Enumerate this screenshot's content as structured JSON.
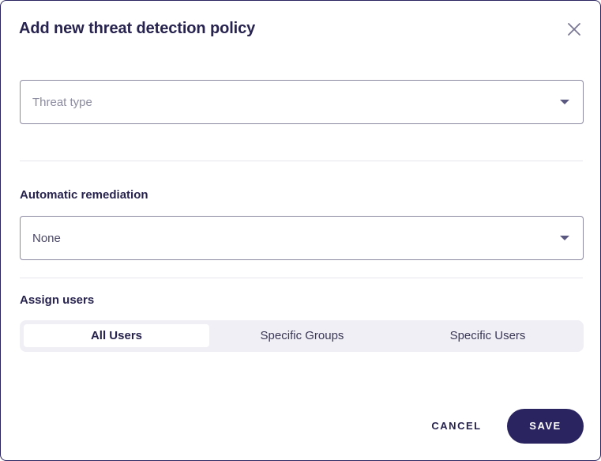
{
  "dialog": {
    "title": "Add new threat detection policy",
    "close_icon": "close-icon"
  },
  "threat_type": {
    "placeholder": "Threat type",
    "value": ""
  },
  "remediation": {
    "label": "Automatic remediation",
    "value": "None"
  },
  "assign_users": {
    "label": "Assign users",
    "options": [
      "All Users",
      "Specific Groups",
      "Specific Users"
    ],
    "selected": "All Users"
  },
  "actions": {
    "cancel_label": "CANCEL",
    "save_label": "SAVE"
  },
  "colors": {
    "primary": "#2a2560",
    "text": "#27234f",
    "placeholder": "#8a8aa0",
    "border": "#8c8aa3",
    "segment_bg": "#f0eff5"
  }
}
